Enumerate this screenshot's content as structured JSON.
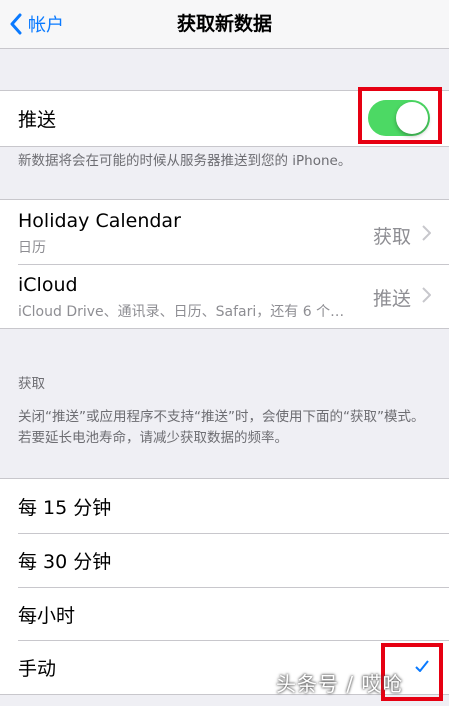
{
  "nav": {
    "back_label": "帐户",
    "title": "获取新数据"
  },
  "push": {
    "label": "推送",
    "enabled": true,
    "footnote": "新数据将会在可能的时候从服务器推送到您的 iPhone。"
  },
  "accounts": [
    {
      "name": "Holiday Calendar",
      "subtitle": "日历",
      "mode": "获取"
    },
    {
      "name": "iCloud",
      "subtitle": "iCloud Drive、通讯录、日历、Safari，还有 6 个…",
      "mode": "推送"
    }
  ],
  "fetch": {
    "header": "获取",
    "footnote": "关闭“推送”或应用程序不支持“推送”时，会使用下面的“获取”模式。若要延长电池寿命，请减少获取数据的频率。",
    "options": [
      "每 15 分钟",
      "每 30 分钟",
      "每小时",
      "手动"
    ],
    "selected": "手动"
  },
  "watermark": "头条号 / 哎呛",
  "colors": {
    "accent": "#0a7aff",
    "toggle_on": "#4cd964",
    "highlight": "#e60012"
  }
}
